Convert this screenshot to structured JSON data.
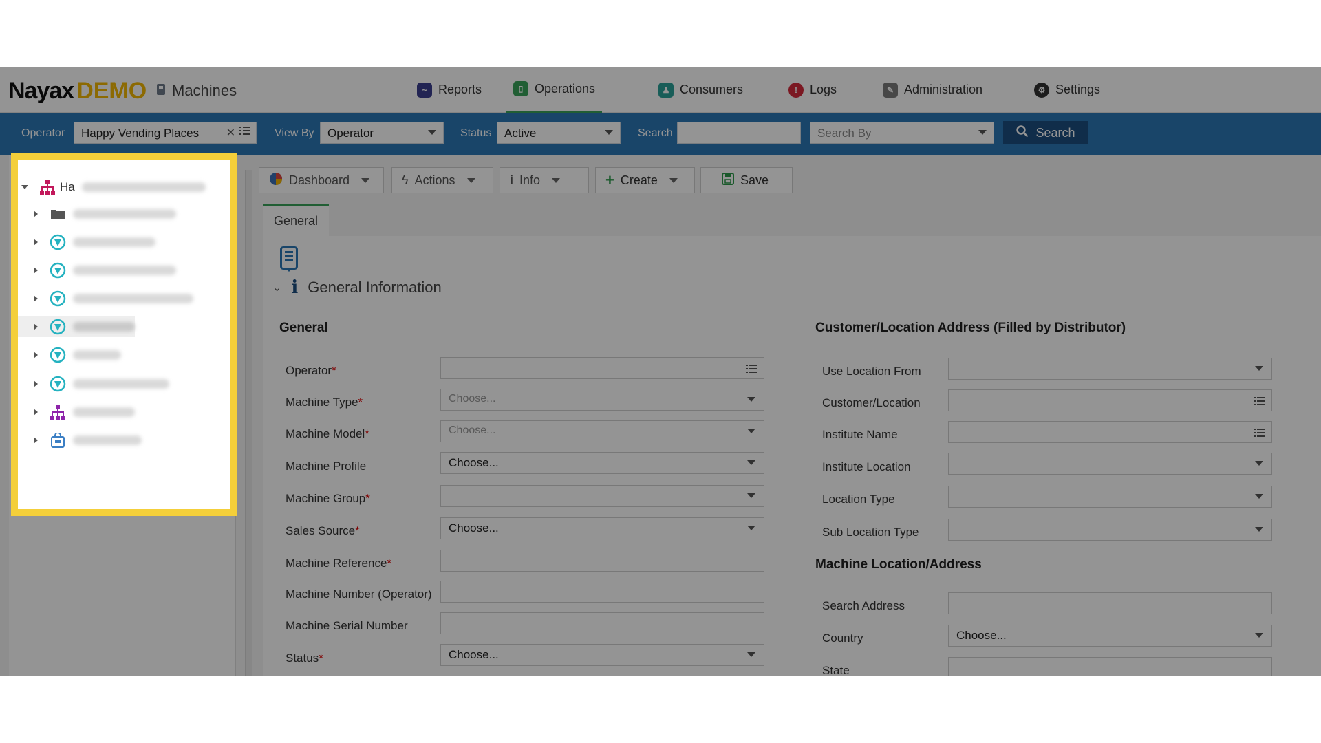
{
  "header": {
    "logo_main": "Nayax",
    "logo_demo": "DEMO",
    "page_title": "Machines"
  },
  "nav": {
    "reports": "Reports",
    "operations": "Operations",
    "consumers": "Consumers",
    "logs": "Logs",
    "administration": "Administration",
    "settings": "Settings",
    "active_tab": "Operations"
  },
  "filters": {
    "operator_label": "Operator",
    "operator_value": "Happy Vending Places",
    "view_by_label": "View By",
    "view_by_value": "Operator",
    "status_label": "Status",
    "status_value": "Active",
    "search_label": "Search",
    "search_value": "",
    "search_by_placeholder": "Search By",
    "search_button": "Search"
  },
  "tree": {
    "root_label": "Ha"
  },
  "content_toolbar": {
    "dashboard": "Dashboard",
    "actions": "Actions",
    "info": "Info",
    "create": "Create",
    "save": "Save"
  },
  "tabs": {
    "general": "General"
  },
  "section": {
    "title": "General Information",
    "left_heading": "General",
    "right_heading": "Customer/Location Address (Filled by Distributor)",
    "location_heading": "Machine Location/Address"
  },
  "left_form": {
    "operator": {
      "label": "Operator",
      "value": ""
    },
    "machine_type": {
      "label": "Machine Type",
      "placeholder": "Choose..."
    },
    "machine_model": {
      "label": "Machine Model",
      "placeholder": "Choose..."
    },
    "machine_profile": {
      "label": "Machine Profile",
      "value": "Choose..."
    },
    "machine_group": {
      "label": "Machine Group",
      "value": ""
    },
    "sales_source": {
      "label": "Sales Source",
      "value": "Choose..."
    },
    "machine_reference": {
      "label": "Machine Reference",
      "value": ""
    },
    "machine_number": {
      "label": "Machine Number (Operator)",
      "value": ""
    },
    "machine_serial": {
      "label": "Machine Serial Number",
      "value": ""
    },
    "status": {
      "label": "Status",
      "value": "Choose..."
    }
  },
  "right_form": {
    "use_location_from": {
      "label": "Use Location From",
      "value": ""
    },
    "customer_location": {
      "label": "Customer/Location",
      "value": ""
    },
    "institute_name": {
      "label": "Institute Name",
      "value": ""
    },
    "institute_location": {
      "label": "Institute Location",
      "value": ""
    },
    "location_type": {
      "label": "Location Type",
      "value": ""
    },
    "sub_location_type": {
      "label": "Sub Location Type",
      "value": ""
    },
    "search_address": {
      "label": "Search Address",
      "value": ""
    },
    "country": {
      "label": "Country",
      "value": "Choose..."
    },
    "state": {
      "label": "State",
      "value": ""
    }
  },
  "required_mark": "*",
  "colors": {
    "toolbar_blue": "#2b77b6",
    "search_button": "#1d4e80",
    "highlight": "#f4cf3a",
    "accent_green": "#3aa35a",
    "required_red": "#d00000"
  }
}
